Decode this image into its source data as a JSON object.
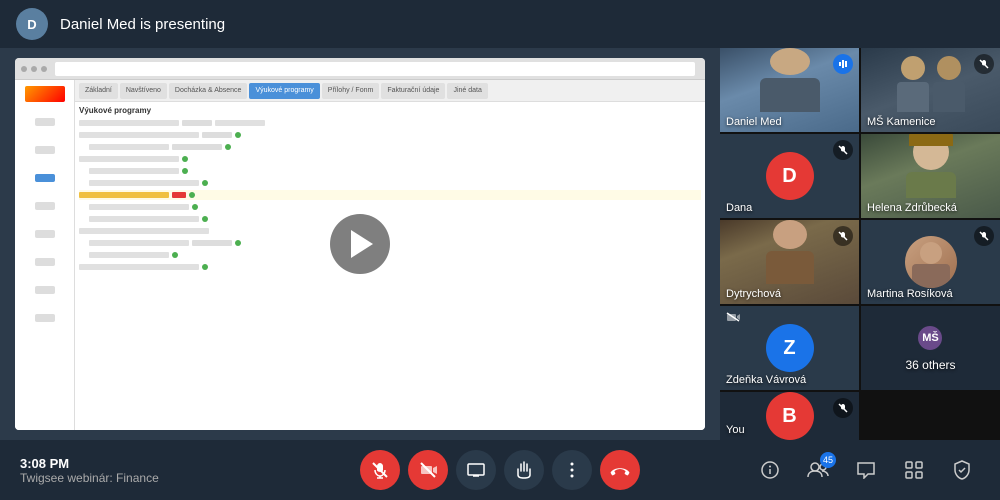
{
  "topBar": {
    "presenterName": "Daniel Med is presenting",
    "presenterInitial": "D"
  },
  "participants": [
    {
      "id": "daniel",
      "name": "Daniel Med",
      "tile": "tile-daniel",
      "muted": false,
      "speaking": true,
      "type": "camera"
    },
    {
      "id": "ms",
      "name": "MŠ Kamenice",
      "tile": "tile-ms",
      "muted": true,
      "type": "camera"
    },
    {
      "id": "dana",
      "name": "Dana",
      "tile": "tile-dana",
      "muted": true,
      "type": "avatar",
      "initial": "D",
      "avatarClass": "avatar-d"
    },
    {
      "id": "helena",
      "name": "Helena Zdrůbecká",
      "tile": "tile-helena",
      "muted": false,
      "type": "camera"
    },
    {
      "id": "dytrychova",
      "name": "Dytrychová",
      "tile": "tile-dytrychova",
      "muted": true,
      "type": "camera"
    },
    {
      "id": "martina",
      "name": "Martina Rosíková",
      "tile": "tile-martina",
      "muted": true,
      "type": "photo"
    },
    {
      "id": "zdenka",
      "name": "Zdeňka Vávrová",
      "tile": "tile-zdenka",
      "muted": false,
      "type": "camera"
    },
    {
      "id": "36others",
      "name": "36 others",
      "tile": "tile-36others",
      "type": "group"
    },
    {
      "id": "you",
      "name": "You",
      "tile": "tile-you",
      "type": "avatar",
      "initial": "B",
      "avatarClass": "avatar-b"
    }
  ],
  "watermark": "twigsee",
  "toolbar": {
    "time": "3:08 PM",
    "meetingTitle": "Twigsee webinár: Finance",
    "micLabel": "Mute",
    "videoLabel": "Stop video",
    "screenShareLabel": "Share screen",
    "raiseHandLabel": "Raise hand",
    "moreLabel": "More",
    "endCallLabel": "End call",
    "participantsLabel": "Participants",
    "participantsBadge": "45",
    "chatLabel": "Chat",
    "appsLabel": "Apps",
    "securityLabel": "Security",
    "infoLabel": "Info"
  },
  "icons": {
    "mic": "🎙",
    "micOff": "🎤",
    "video": "📹",
    "videoOff": "🚫",
    "screen": "🖥",
    "hand": "✋",
    "more": "⋮",
    "endCall": "📵",
    "info": "ℹ",
    "participants": "👥",
    "chat": "💬",
    "apps": "⊞",
    "security": "🔒",
    "speaking": "🔊",
    "muted": "🔇",
    "cameraMuted": "📷"
  }
}
